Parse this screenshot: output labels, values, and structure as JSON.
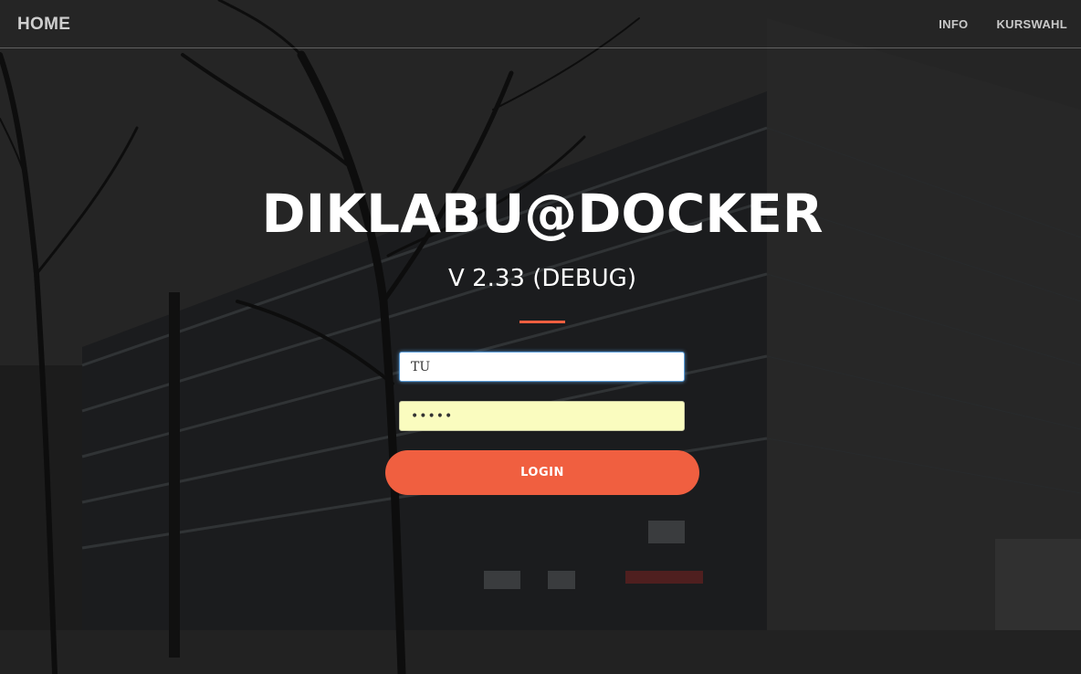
{
  "navbar": {
    "brand": "HOME",
    "links": [
      {
        "label": "INFO"
      },
      {
        "label": "KURSWAHL"
      }
    ]
  },
  "hero": {
    "title": "DIKLABU@DOCKER",
    "subtitle": "V 2.33 (DEBUG)"
  },
  "login_form": {
    "username_value": "TU",
    "password_value": "•••••",
    "login_label": "LOGIN"
  },
  "colors": {
    "accent": "#f05f40",
    "overlay": "#1d1d1d",
    "autofill_background": "#fafcbf"
  }
}
